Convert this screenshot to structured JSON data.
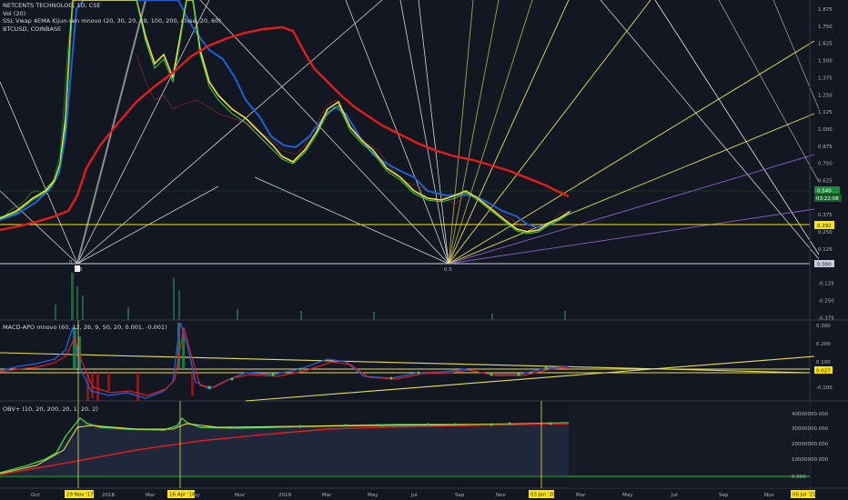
{
  "main_legend": {
    "title": "NETCENTS TECHNOLOG, 1D, CSE",
    "vol": "Vol (20)",
    "ssl": "SSL Vwap 4EMA Kijun-sen mnovo (20, 30, 20, 49, 100, 200, close, 20, 60)",
    "compare": "BTCUSD, COINBASE"
  },
  "macd_legend": "MACD-APO mnovo (60, 12, 26, 9, 50, 20, 0.001, -0.001)",
  "obv_legend": "OBV+ (10, 20, 200, 20, 1, 20, 2)",
  "price_axis": [
    "1.875",
    "1.750",
    "1.625",
    "1.500",
    "1.375",
    "1.250",
    "1.125",
    "1.000",
    "0.875",
    "0.750",
    "0.625",
    "0.500",
    "0.375",
    "0.250",
    "0.125",
    "0.000",
    "-0.125",
    "-0.250",
    "-0.375"
  ],
  "price_badges": {
    "last": "0.540",
    "countdown": "03:22:08",
    "level": "0.292",
    "zero": "0.000"
  },
  "macd_axis": [
    "0.300",
    "0.200",
    "0.100",
    "-0.100"
  ],
  "macd_badge": "0.027",
  "obv_axis": [
    "40000000.000",
    "30000000.000",
    "20000000.000",
    "10000000.000",
    "0.000"
  ],
  "x_axis": [
    "Oct",
    "2018",
    "Mar",
    "May",
    "Nov",
    "2019",
    "Mar",
    "May",
    "Jul",
    "Sep",
    "Nov",
    "Mar",
    "May",
    "Jul",
    "Sep",
    "Nov"
  ],
  "date_badges": [
    "29 Nov '17",
    "16 Apr '18",
    "03 Jan '20",
    "06 Jul '21"
  ],
  "fib_labels": [
    "0",
    "0.5",
    "0.5"
  ],
  "colors": {
    "background": "#131722",
    "ema_red": "#e31c1c",
    "kijun_blue": "#1f5fd6",
    "fast_yellow": "#f2e13a",
    "fast_green": "#3fd14a",
    "fan_yellow": "#e8df52",
    "fan_purple": "#8a5fc7",
    "gann_white": "#e8e8e8",
    "level_yellow": "#ffe500"
  }
}
